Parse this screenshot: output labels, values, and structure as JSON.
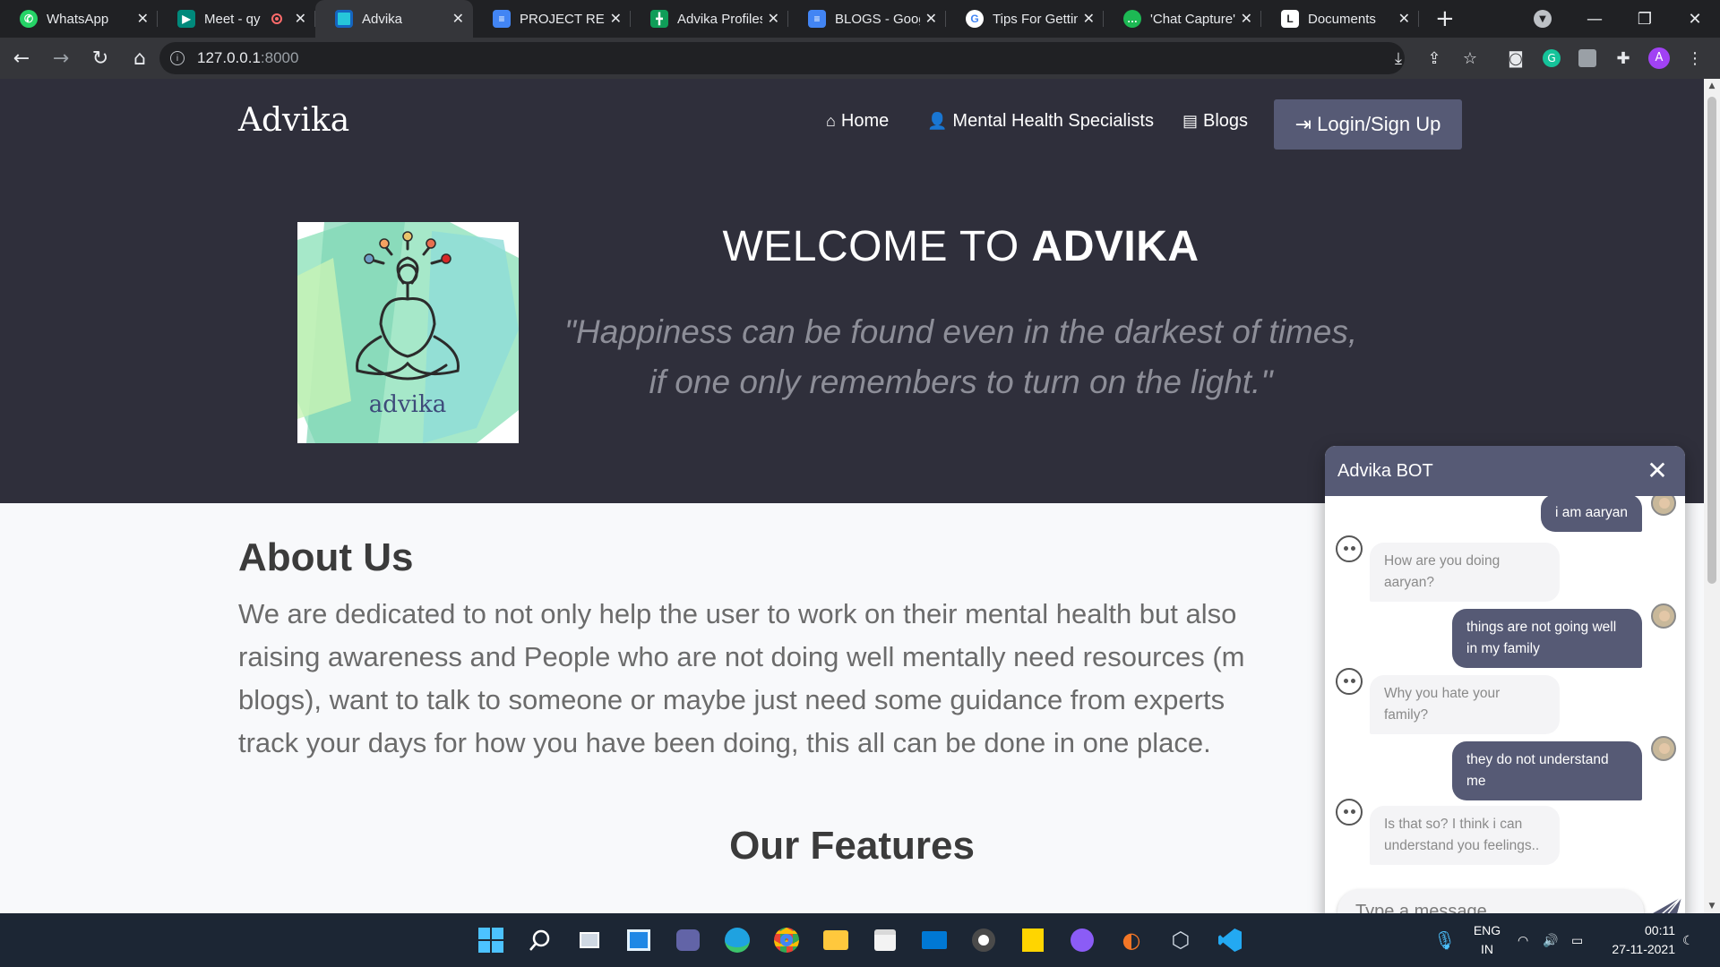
{
  "browser": {
    "tabs": [
      {
        "label": "WhatsApp",
        "icon": "whatsapp-icon",
        "color": "#25d366"
      },
      {
        "label": "Meet - qy",
        "icon": "meet-icon",
        "color": "#00897b",
        "recording": true
      },
      {
        "label": "Advika",
        "icon": "advika-icon",
        "color": "#26c6da",
        "active": true
      },
      {
        "label": "PROJECT REPC",
        "icon": "docs-icon",
        "color": "#4285f4"
      },
      {
        "label": "Advika Profiles",
        "icon": "sheets-icon",
        "color": "#0f9d58"
      },
      {
        "label": "BLOGS - Goog",
        "icon": "docs-icon",
        "color": "#4285f4"
      },
      {
        "label": "Tips For Gettin",
        "icon": "google-icon",
        "color": "#ffffff"
      },
      {
        "label": "'Chat Capture'",
        "icon": "chat-icon",
        "color": "#1db954"
      },
      {
        "label": "Documents",
        "icon": "document-icon",
        "color": "#ffffff"
      }
    ],
    "new_tab": "+",
    "url_host": "127.0.0.1",
    "url_port": ":8000"
  },
  "site": {
    "brand": "Advika",
    "nav": {
      "home": "Home",
      "specialists": "Mental Health Specialists",
      "blogs": "Blogs",
      "login": "Login/Sign Up"
    },
    "logo_text": "advika",
    "welcome_prefix": "WELCOME TO ",
    "welcome_bold": "ADVIKA",
    "quote_line1": "\"Happiness can be found even in the darkest of times,",
    "quote_line2": "if one only remembers to turn on the light.\"",
    "about_title": "About Us",
    "about_lines": [
      "We are dedicated to not only help the user to work on their mental health but also",
      "raising awareness and People who are not doing well mentally need resources (m",
      "blogs), want to talk to someone or maybe just need some guidance from experts",
      "track your days for how you have been doing, this all can be done in one place."
    ],
    "features_title": "Our Features"
  },
  "chat": {
    "title": "Advika BOT",
    "close": "✕",
    "messages": [
      {
        "from": "user",
        "text": "i am aaryan"
      },
      {
        "from": "bot",
        "text": "How are you doing aaryan?"
      },
      {
        "from": "user",
        "text": "things are not going well in my family"
      },
      {
        "from": "bot",
        "text": "Why you hate your family?"
      },
      {
        "from": "user",
        "text": "they do not understand me"
      },
      {
        "from": "bot",
        "text": "Is that so? I think i can understand you feelings.."
      }
    ],
    "input_placeholder": "Type a message..."
  },
  "taskbar": {
    "lang_line1": "ENG",
    "lang_line2": "IN",
    "time": "00:11",
    "date": "27-11-2021"
  },
  "colors": {
    "hero_bg": "#2f2f3b",
    "accent": "#565a75",
    "chrome_dark": "#202124",
    "chrome_toolbar": "#35363a"
  }
}
